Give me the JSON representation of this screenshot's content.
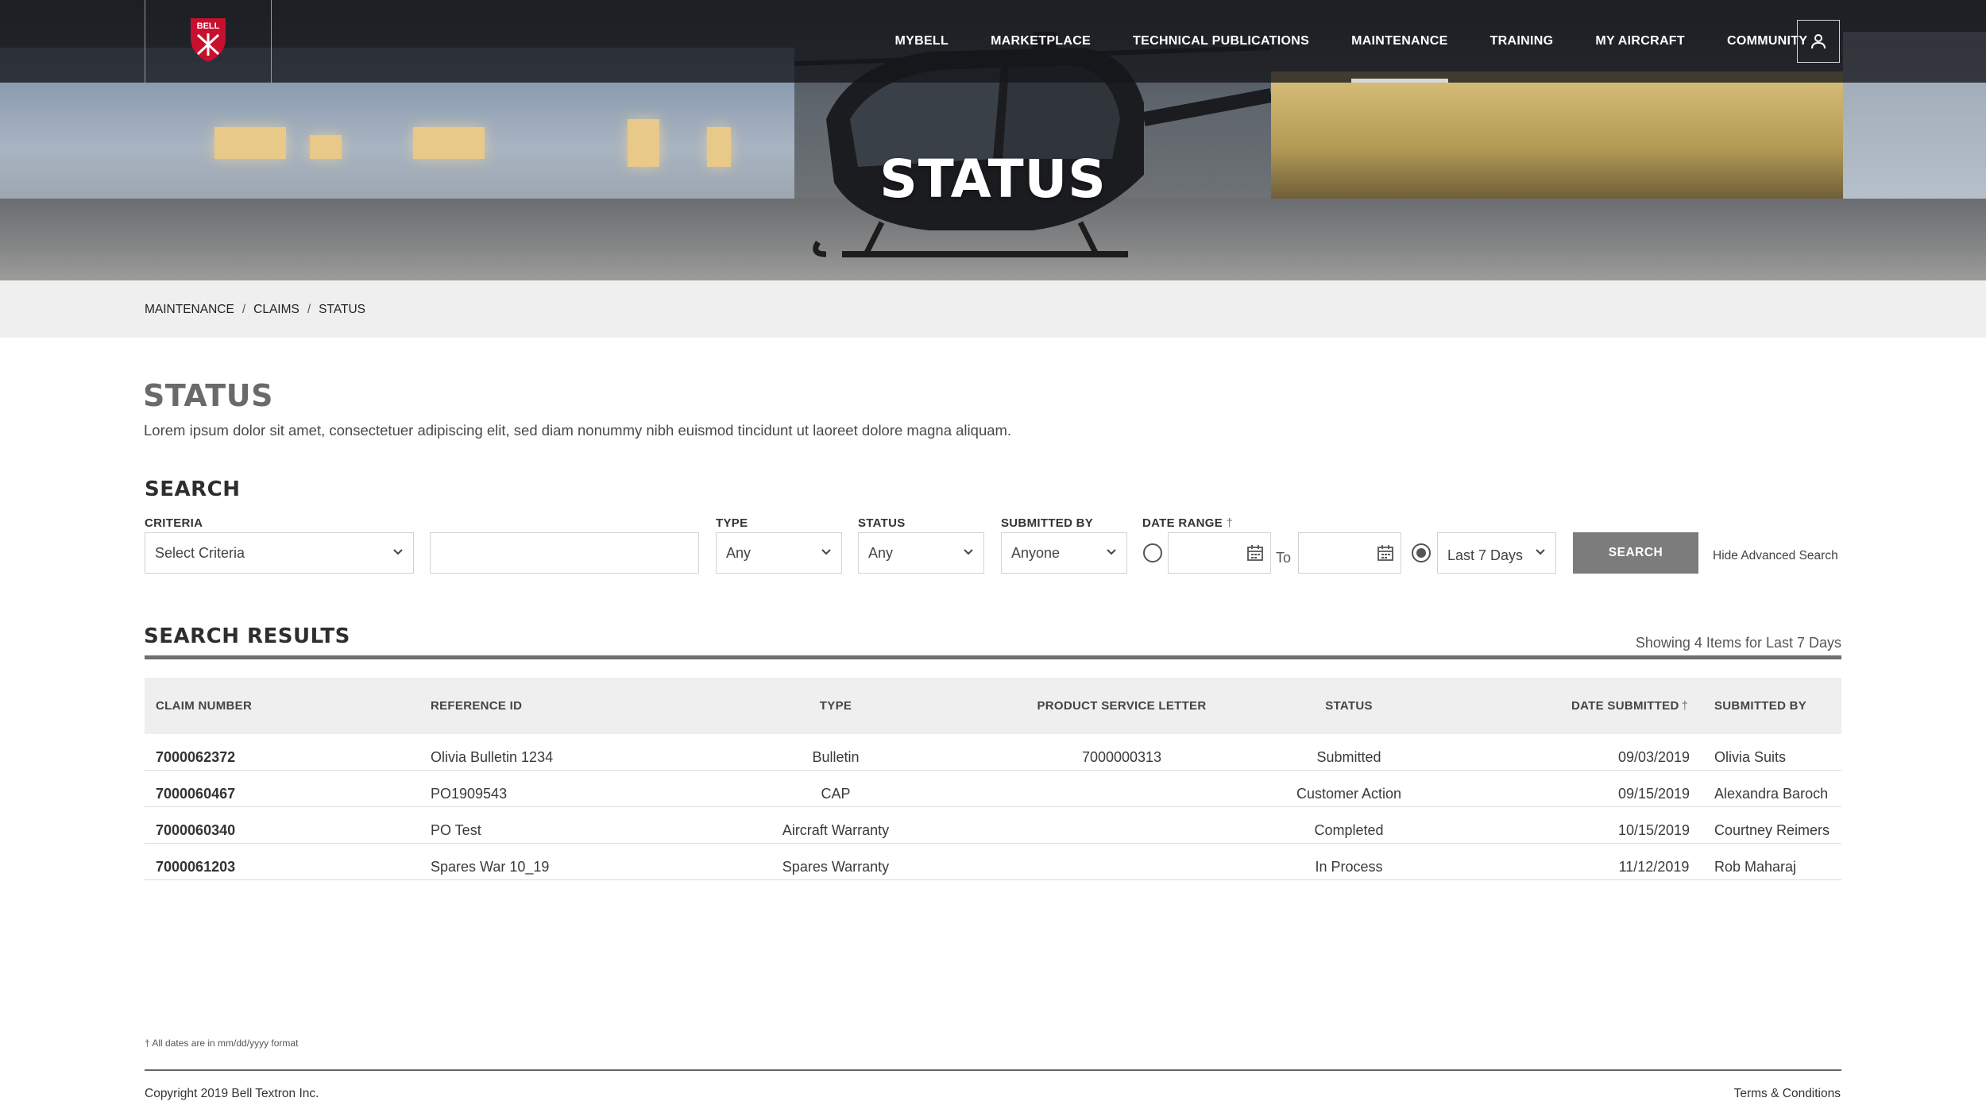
{
  "brand": {
    "logo_text": "BELL",
    "accent": "#c8102e"
  },
  "nav": {
    "items": [
      {
        "label": "MYBELL",
        "active": false
      },
      {
        "label": "MARKETPLACE",
        "active": false
      },
      {
        "label": "TECHNICAL PUBLICATIONS",
        "active": false
      },
      {
        "label": "MAINTENANCE",
        "active": true
      },
      {
        "label": "TRAINING",
        "active": false
      },
      {
        "label": "MY AIRCRAFT",
        "active": false
      },
      {
        "label": "COMMUNITY",
        "active": false
      }
    ],
    "user_icon": "user-icon"
  },
  "hero": {
    "title": "STATUS"
  },
  "breadcrumb": [
    "MAINTENANCE",
    "CLAIMS",
    "STATUS"
  ],
  "page": {
    "title": "STATUS",
    "description": "Lorem ipsum dolor sit amet, consectetuer adipiscing elit, sed diam nonummy nibh euismod tincidunt ut laoreet dolore magna aliquam."
  },
  "search": {
    "heading": "SEARCH",
    "criteria_label": "CRITERIA",
    "criteria_value": "Select Criteria",
    "criteria_text_value": "",
    "type_label": "TYPE",
    "type_value": "Any",
    "status_label": "STATUS",
    "status_value": "Any",
    "submitted_by_label": "SUBMITTED BY",
    "submitted_by_value": "Anyone",
    "date_range_label": "DATE RANGE",
    "date_range_mark": "†",
    "date_from": "",
    "to_label": "To",
    "date_to": "",
    "preset_value": "Last 7 Days",
    "preset_selected": true,
    "button_label": "SEARCH",
    "advanced_link": "Hide Advanced Search"
  },
  "results": {
    "heading": "SEARCH RESULTS",
    "summary": "Showing 4 Items for Last 7 Days",
    "columns": {
      "claim_number": "CLAIM NUMBER",
      "reference_id": "REFERENCE ID",
      "type": "TYPE",
      "product_service_letter": "PRODUCT SERVICE LETTER",
      "status": "STATUS",
      "date_submitted": "DATE SUBMITTED",
      "date_submitted_mark": "†",
      "submitted_by": "SUBMITTED BY"
    },
    "rows": [
      {
        "claim_number": "7000062372",
        "reference_id": "Olivia Bulletin 1234",
        "type": "Bulletin",
        "psl": "7000000313",
        "status": "Submitted",
        "date": "09/03/2019",
        "submitted_by": "Olivia Suits"
      },
      {
        "claim_number": "7000060467",
        "reference_id": "PO1909543",
        "type": "CAP",
        "psl": "",
        "status": "Customer Action",
        "date": "09/15/2019",
        "submitted_by": "Alexandra Baroch"
      },
      {
        "claim_number": "7000060340",
        "reference_id": "PO Test",
        "type": "Aircraft Warranty",
        "psl": "",
        "status": "Completed",
        "date": "10/15/2019",
        "submitted_by": "Courtney Reimers"
      },
      {
        "claim_number": "7000061203",
        "reference_id": "Spares War 10_19",
        "type": "Spares Warranty",
        "psl": "",
        "status": "In Process",
        "date": "11/12/2019",
        "submitted_by": "Rob Maharaj"
      }
    ]
  },
  "footer": {
    "footnote": "† All dates are in mm/dd/yyyy format",
    "copyright": "Copyright 2019 Bell Textron Inc.",
    "terms": "Terms & Conditions"
  }
}
